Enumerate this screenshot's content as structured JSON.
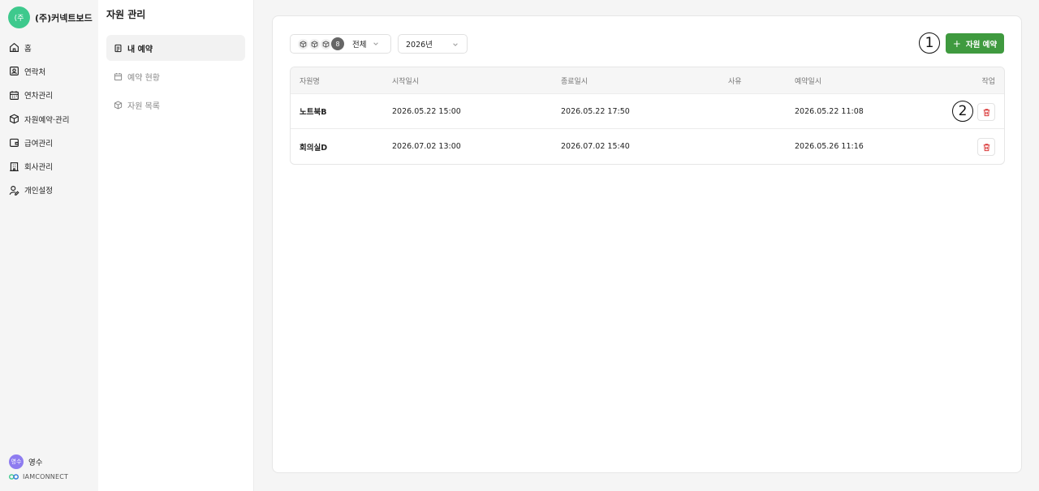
{
  "company": {
    "logo_text": "(주",
    "name": "(주)커넥트보드"
  },
  "nav": {
    "items": [
      {
        "label": "홈",
        "icon": "home-icon"
      },
      {
        "label": "연락처",
        "icon": "contact-icon"
      },
      {
        "label": "연차관리",
        "icon": "calendar-icon"
      },
      {
        "label": "자원예약·관리",
        "icon": "box-icon"
      },
      {
        "label": "급여관리",
        "icon": "wallet-icon"
      },
      {
        "label": "회사관리",
        "icon": "building-icon"
      },
      {
        "label": "개인설정",
        "icon": "user-settings-icon"
      }
    ]
  },
  "user": {
    "avatar_text": "영수",
    "name": "영수"
  },
  "brand": {
    "name": "IAMCONNECT"
  },
  "subnav": {
    "title": "자원 관리",
    "items": [
      {
        "label": "내 예약",
        "icon": "clipboard-icon",
        "active": true
      },
      {
        "label": "예약 현황",
        "icon": "calendar-icon",
        "active": false
      },
      {
        "label": "자원 목록",
        "icon": "box-icon",
        "active": false
      }
    ]
  },
  "toolbar": {
    "filter_count": "8",
    "filter_value": "전체",
    "year_value": "2026년",
    "add_label": "자원 예약"
  },
  "table": {
    "headers": [
      "자원명",
      "시작일시",
      "종료일시",
      "사유",
      "예약일시",
      "작업"
    ],
    "rows": [
      {
        "name": "노트북B",
        "start": "2026.05.22 15:00",
        "end": "2026.05.22 17:50",
        "reason": "",
        "reserved": "2026.05.22 11:08"
      },
      {
        "name": "회의실D",
        "start": "2026.07.02 13:00",
        "end": "2026.07.02 15:40",
        "reason": "",
        "reserved": "2026.05.26 11:16"
      }
    ]
  },
  "annotations": {
    "mark1": "1",
    "mark2": "2"
  },
  "colors": {
    "accent_green": "#3f9a3f",
    "logo_green": "#3ec98d",
    "avatar_purple": "#8e7cf0",
    "delete_red": "#d93636"
  }
}
